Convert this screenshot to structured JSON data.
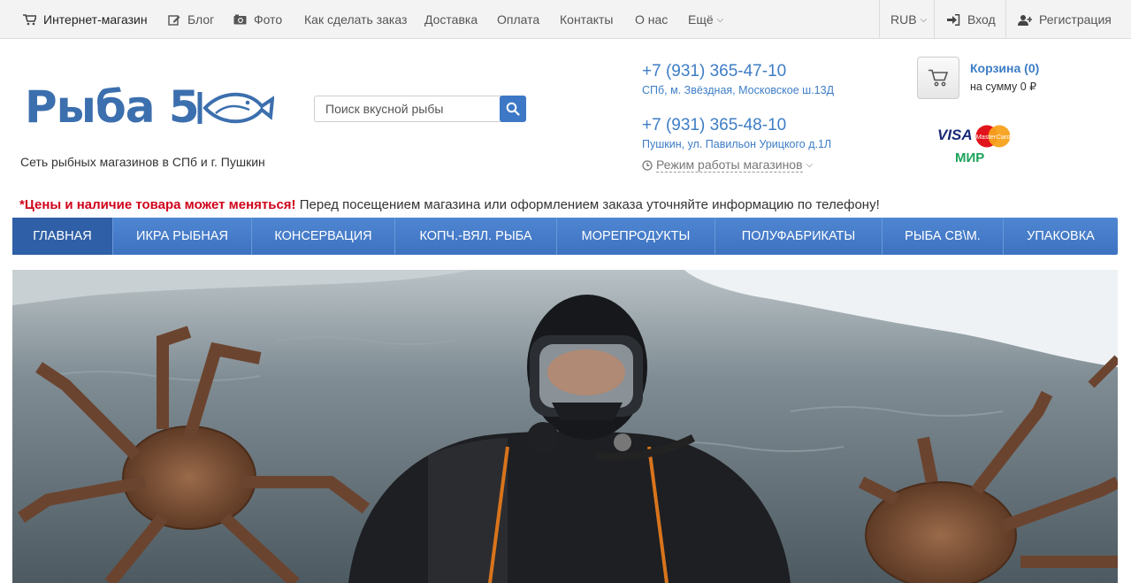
{
  "topbar": {
    "shop": "Интернет-магазин",
    "blog": "Блог",
    "photo": "Фото",
    "how_to_order": "Как сделать заказ",
    "delivery": "Доставка",
    "payment": "Оплата",
    "contacts": "Контакты",
    "about": "О нас",
    "more": "Ещё",
    "currency": "RUB",
    "login": "Вход",
    "register": "Регистрация"
  },
  "logo": {
    "text": "Рыба 5"
  },
  "tagline": "Сеть рыбных магазинов в СПб и г. Пушкин",
  "search": {
    "placeholder": "Поиск вкусной рыбы"
  },
  "contacts": {
    "phone1": "+7 (931) 365-47-10",
    "addr1": "СПб, м. Звёздная, Московское ш.13Д",
    "phone2": "+7 (931) 365-48-10",
    "addr2": "Пушкин, ул. Павильон Урицкого д.1Л",
    "hours": "Режим работы магазинов"
  },
  "cart": {
    "title": "Корзина (0)",
    "sum": "на сумму 0 ₽"
  },
  "payment_logos": {
    "visa": "VISA",
    "mastercard": "MasterCard",
    "mir": "МИР"
  },
  "notice": {
    "bold": "*Цены и наличие товара может меняться!",
    "text": " Перед посещением магазина или оформлением заказа уточняйте информацию по телефону!"
  },
  "nav": {
    "items": [
      {
        "label": "ГЛАВНАЯ"
      },
      {
        "label": "ИКРА РЫБНАЯ"
      },
      {
        "label": "КОНСЕРВАЦИЯ"
      },
      {
        "label": "КОПЧ.-ВЯЛ. РЫБА"
      },
      {
        "label": "МОРЕПРОДУКТЫ"
      },
      {
        "label": "ПОЛУФАБРИКАТЫ"
      },
      {
        "label": "РЫБА СВ\\М."
      },
      {
        "label": "УПАКОВКА"
      }
    ]
  },
  "colors": {
    "accent": "#3d7dc6",
    "nav": "#4a80cc",
    "nav_active": "#2f5fa6",
    "notice_red": "#d0021b"
  }
}
